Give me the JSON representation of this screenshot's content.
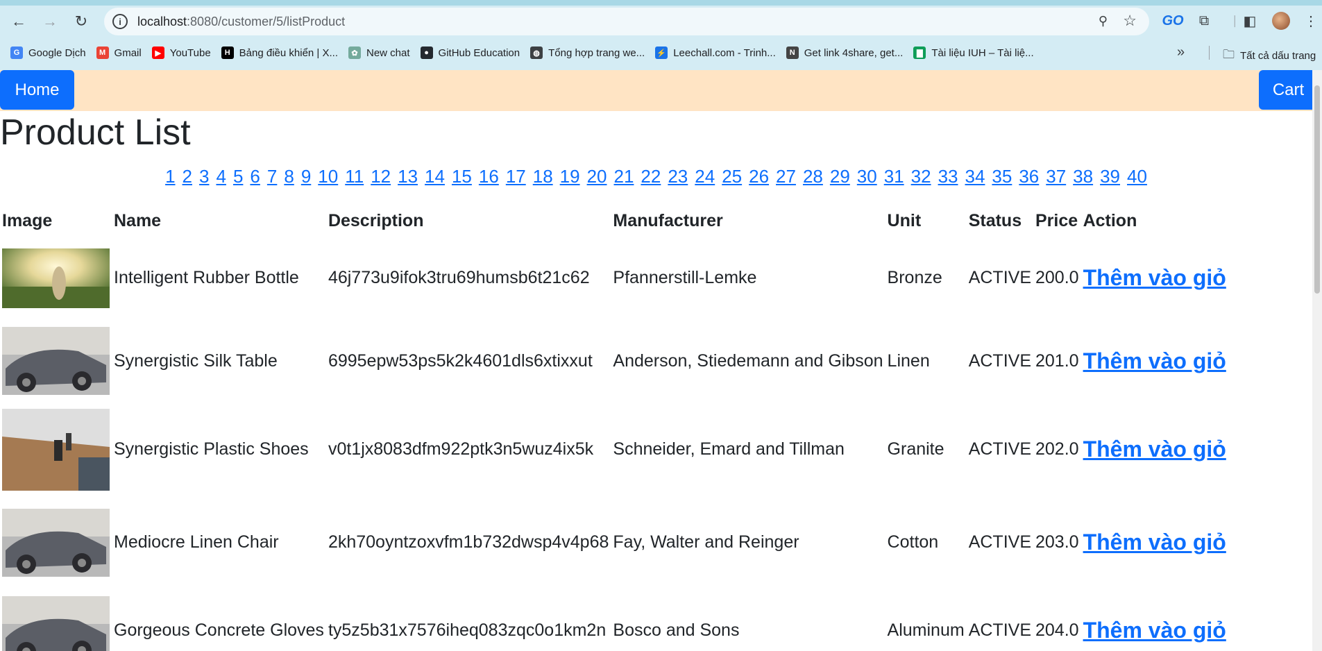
{
  "browser": {
    "url_host": "localhost",
    "url_path": ":8080/customer/5/listProduct",
    "extension_label": "GO",
    "bookmarks": [
      {
        "label": "Google Dịch",
        "color": "#4285f4",
        "glyph": "G"
      },
      {
        "label": "Gmail",
        "color": "#ea4335",
        "glyph": "M"
      },
      {
        "label": "YouTube",
        "color": "#ff0000",
        "glyph": "▶"
      },
      {
        "label": "Bảng điều khiển | X...",
        "color": "#000000",
        "glyph": "H"
      },
      {
        "label": "New chat",
        "color": "#74aa9c",
        "glyph": "✿"
      },
      {
        "label": "GitHub Education",
        "color": "#24292f",
        "glyph": "●"
      },
      {
        "label": "Tổng hợp trang we...",
        "color": "#3c4043",
        "glyph": "◍"
      },
      {
        "label": "Leechall.com - Trinh...",
        "color": "#1a73e8",
        "glyph": "⚡"
      },
      {
        "label": "Get link 4share, get...",
        "color": "#444444",
        "glyph": "N"
      },
      {
        "label": "Tài liệu IUH – Tài liệ...",
        "color": "#0f9d58",
        "glyph": "▇"
      }
    ],
    "all_bookmarks_label": "Tất cả dấu trang"
  },
  "nav": {
    "home_label": "Home",
    "cart_label": "Cart"
  },
  "page_title": "Product List",
  "pagination": [
    "1",
    "2",
    "3",
    "4",
    "5",
    "6",
    "7",
    "8",
    "9",
    "10",
    "11",
    "12",
    "13",
    "14",
    "15",
    "16",
    "17",
    "18",
    "19",
    "20",
    "21",
    "22",
    "23",
    "24",
    "25",
    "26",
    "27",
    "28",
    "29",
    "30",
    "31",
    "32",
    "33",
    "34",
    "35",
    "36",
    "37",
    "38",
    "39",
    "40"
  ],
  "table": {
    "headers": [
      "Image",
      "Name",
      "Description",
      "Manufacturer",
      "Unit",
      "Status",
      "Price",
      "Action"
    ],
    "rows": [
      {
        "image": "sunset-woman",
        "name": "Intelligent Rubber Bottle",
        "description": "46j773u9ifok3tru69humsb6t21c62",
        "manufacturer": "Pfannerstill-Lemke",
        "unit": "Bronze",
        "status": "ACTIVE",
        "price": "200.0",
        "action": "Thêm vào giỏ"
      },
      {
        "image": "vintage-car",
        "name": "Synergistic Silk Table",
        "description": "6995epw53ps5k2k4601dls6xtixxut",
        "manufacturer": "Anderson, Stiedemann and Gibson",
        "unit": "Linen",
        "status": "ACTIVE",
        "price": "201.0",
        "action": "Thêm vào giỏ"
      },
      {
        "image": "desk-hand",
        "name": "Synergistic Plastic Shoes",
        "description": "v0t1jx8083dfm922ptk3n5wuz4ix5k",
        "manufacturer": "Schneider, Emard and Tillman",
        "unit": "Granite",
        "status": "ACTIVE",
        "price": "202.0",
        "action": "Thêm vào giỏ"
      },
      {
        "image": "vintage-car",
        "name": "Mediocre Linen Chair",
        "description": "2kh70oyntzoxvfm1b732dwsp4v4p68",
        "manufacturer": "Fay, Walter and Reinger",
        "unit": "Cotton",
        "status": "ACTIVE",
        "price": "203.0",
        "action": "Thêm vào giỏ"
      },
      {
        "image": "vintage-car",
        "name": "Gorgeous Concrete Gloves",
        "description": "ty5z5b31x7576iheq083zqc0o1km2n",
        "manufacturer": "Bosco and Sons",
        "unit": "Aluminum",
        "status": "ACTIVE",
        "price": "204.0",
        "action": "Thêm vào giỏ"
      }
    ]
  }
}
